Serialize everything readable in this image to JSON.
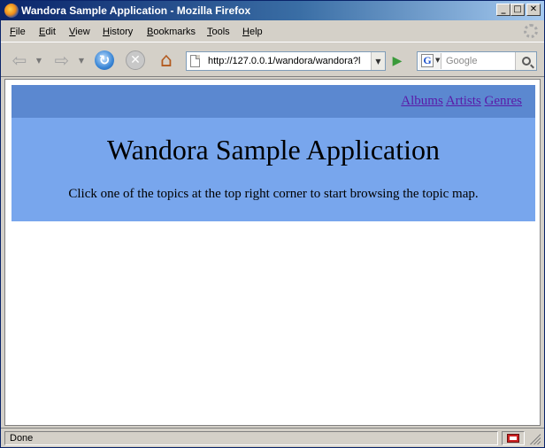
{
  "window": {
    "title": "Wandora Sample Application - Mozilla Firefox",
    "minimize": "_",
    "maximize": "□",
    "close": "✕"
  },
  "menubar": {
    "items": [
      {
        "label": "File",
        "accel": "F",
        "rest": "ile"
      },
      {
        "label": "Edit",
        "accel": "E",
        "rest": "dit"
      },
      {
        "label": "View",
        "accel": "V",
        "rest": "iew"
      },
      {
        "label": "History",
        "accel": "H",
        "rest": "istory"
      },
      {
        "label": "Bookmarks",
        "accel": "B",
        "rest": "ookmarks"
      },
      {
        "label": "Tools",
        "accel": "T",
        "rest": "ools"
      },
      {
        "label": "Help",
        "accel": "H",
        "rest": "elp"
      }
    ]
  },
  "toolbar": {
    "url": "http://127.0.0.1/wandora/wandora?l",
    "search_placeholder": "Google",
    "search_engine_glyph": "G",
    "icons": [
      "back-icon",
      "forward-icon",
      "reload-icon",
      "stop-icon",
      "home-icon",
      "go-icon",
      "search-icon"
    ]
  },
  "page": {
    "nav_links": [
      "Albums",
      "Artists",
      "Genres"
    ],
    "heading": "Wandora Sample Application",
    "intro": "Click one of the topics at the top right corner to start browsing the topic map.",
    "colors": {
      "header_top": "#5b88d0",
      "header_main": "#78a6ed",
      "link": "#5a1aa8"
    }
  },
  "status": {
    "text": "Done"
  }
}
